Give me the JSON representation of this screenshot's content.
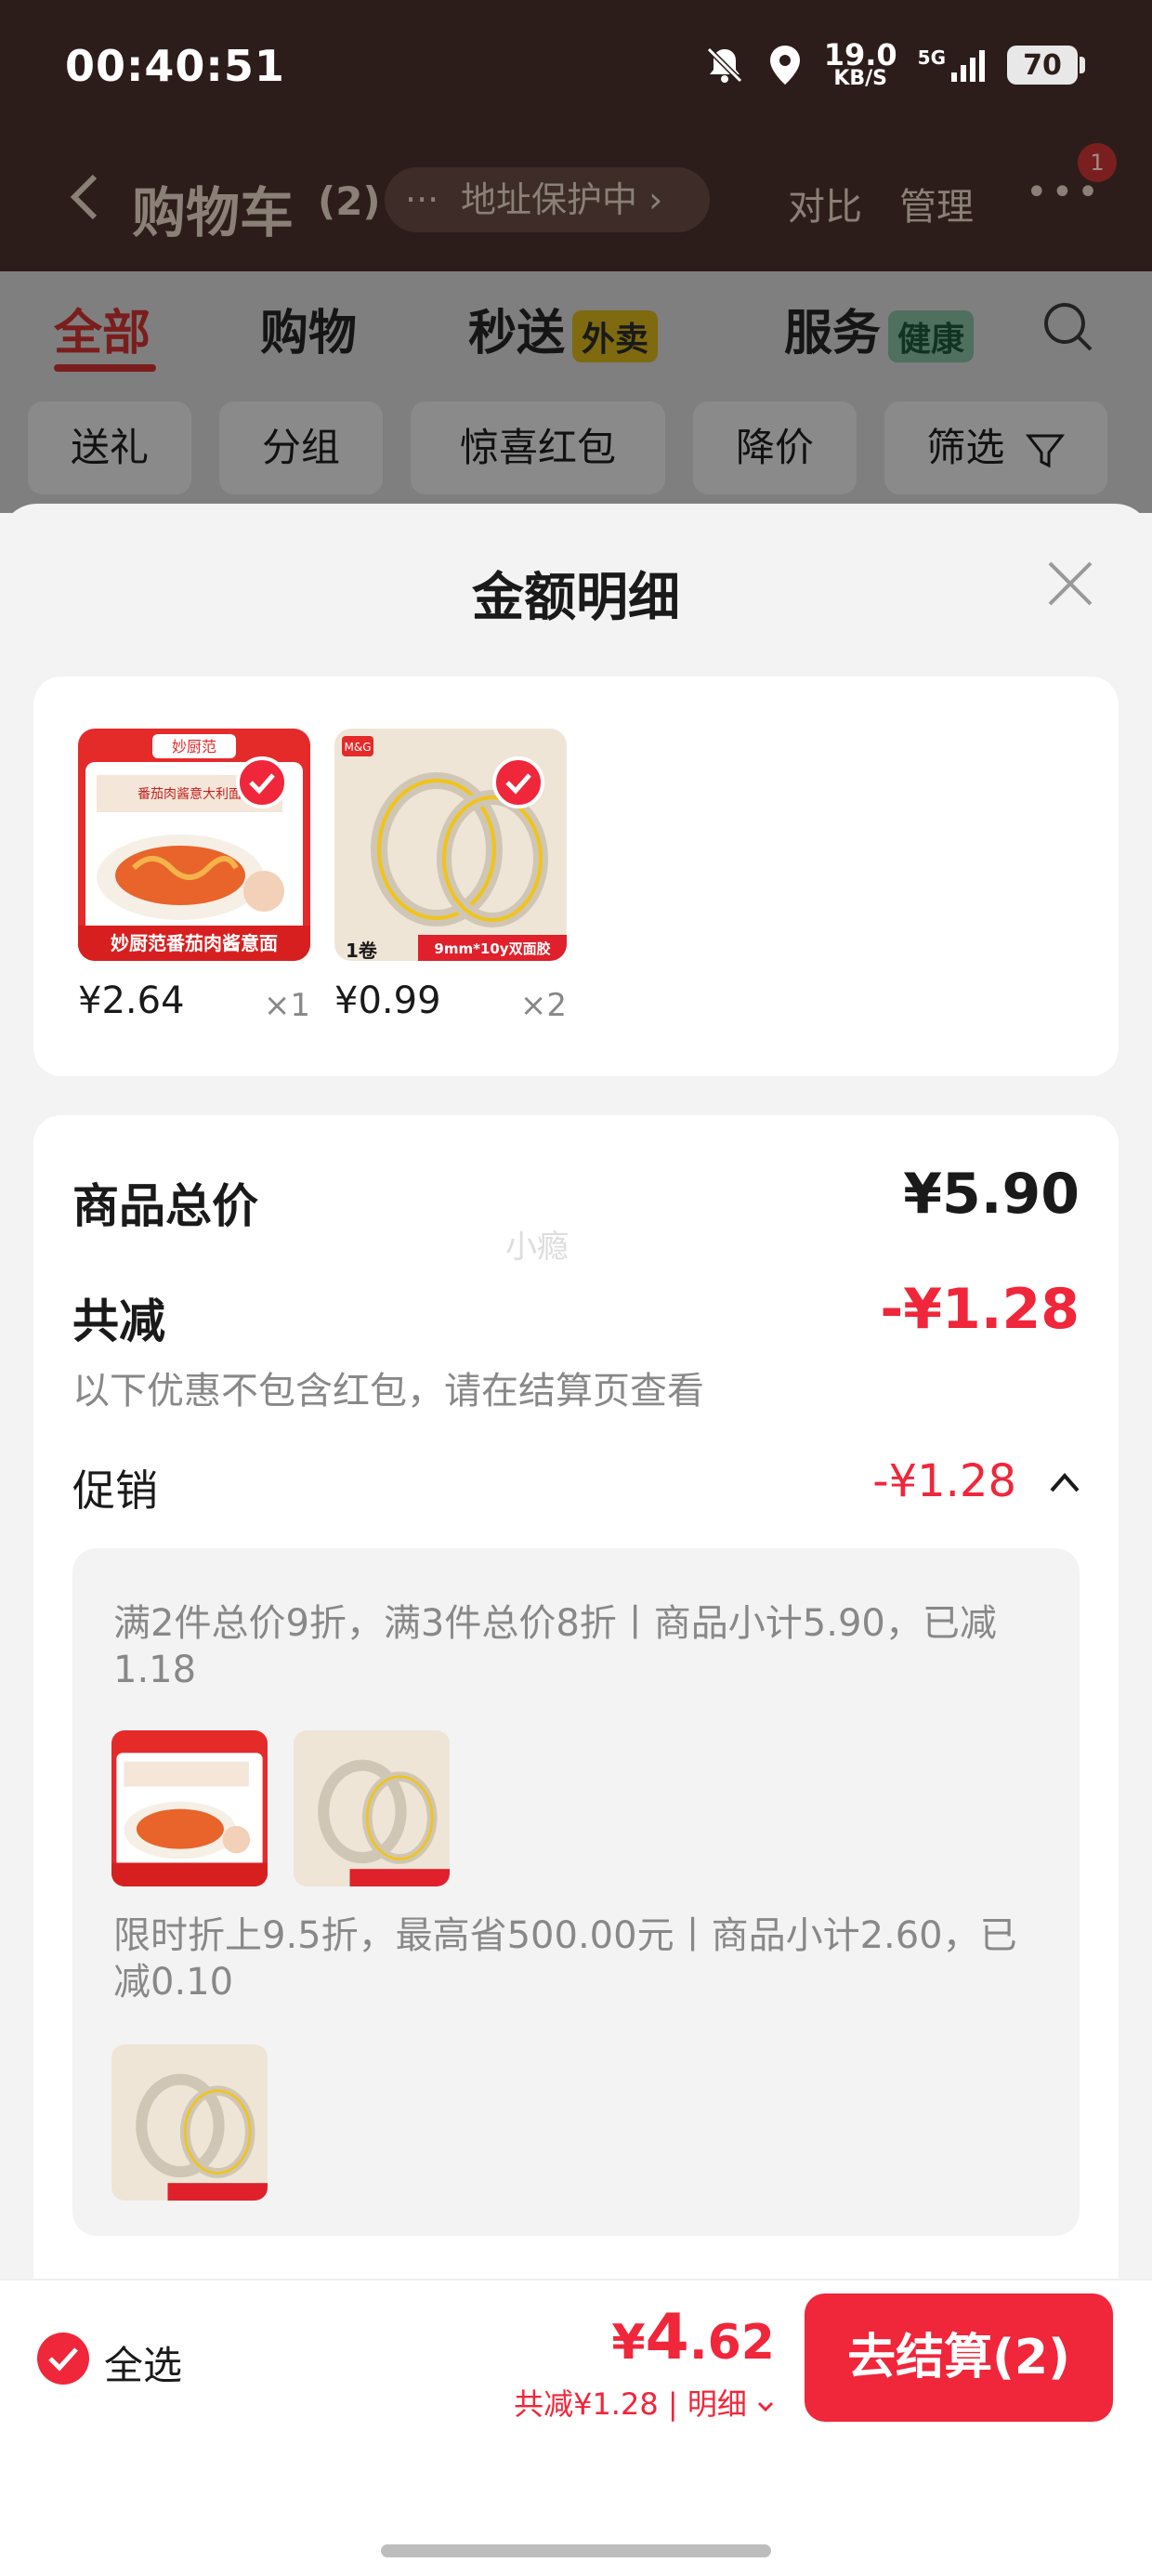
{
  "status_bar": {
    "time": "00:40:51",
    "net_speed_value": "19.0",
    "net_speed_unit": "KB/S",
    "signal_label": "5G",
    "battery": "70"
  },
  "nav": {
    "back_icon": "chevron-left-icon",
    "title": "购物车",
    "count": "(2)",
    "address_pill": "地址保护中",
    "compare": "对比",
    "manage": "管理",
    "more_badge": "1"
  },
  "tabs": [
    {
      "label": "全部",
      "active": true
    },
    {
      "label": "购物"
    },
    {
      "label": "秒送",
      "tag": "外卖"
    },
    {
      "label": "服务",
      "tag": "健康"
    }
  ],
  "chips": [
    "送礼",
    "分组",
    "惊喜红包",
    "降价",
    "筛选"
  ],
  "sheet": {
    "title": "金额明细",
    "products": [
      {
        "name": "妙厨范番茄肉酱意面",
        "price": "¥2.64",
        "qty": "×1"
      },
      {
        "name": "9mm*10y双面胶",
        "price": "¥0.99",
        "qty": "×2"
      }
    ],
    "goods_total_label": "商品总价",
    "goods_total_value": "¥5.90",
    "discount_label": "共减",
    "discount_value": "-¥1.28",
    "discount_note": "以下优惠不包含红包，请在结算页查看",
    "watermark": "小瘾",
    "promo_label": "促销",
    "promo_value": "-¥1.28",
    "promos": [
      {
        "text": "满2件总价9折，满3件总价8折丨商品小计5.90，已减1.18"
      },
      {
        "text": "限时折上9.5折，最高省500.00元丨商品小计2.60，已减0.10"
      }
    ]
  },
  "product_art": {
    "pasta_brand": "妙厨范",
    "pasta_banner": "妙厨范番茄肉酱意面",
    "pasta_box_title": "番茄肉酱意大利面",
    "tape_brand": "M&G",
    "tape_count": "1卷",
    "tape_banner": "9mm*10y双面胶"
  },
  "bottom_bar": {
    "select_all": "全选",
    "total_yen": "¥",
    "total_int": "4",
    "total_dec": ".62",
    "sub_text": "共减¥1.28 | 明细",
    "checkout": "去结算(2)"
  },
  "colors": {
    "accent_red": "#f0263a",
    "header_dark": "#2d1d1a",
    "overlay_gray": "#7f7f7f"
  }
}
